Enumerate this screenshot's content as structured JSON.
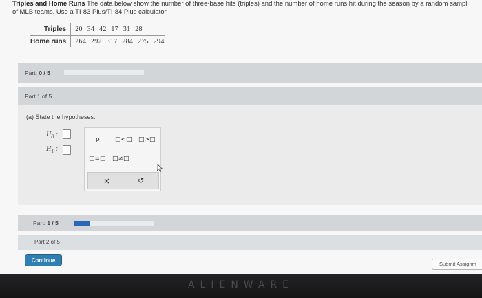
{
  "question": {
    "title": "Triples and Home Runs",
    "text_line1": "The data below show the number of three-base hits (triples) and the number of home runs hit during the season by a random sampl",
    "text_line2": "of MLB teams. Use a TI-83 Plus/TI-84 Plus calculator."
  },
  "table": {
    "row1_label": "Triples",
    "row1_values": "20 34 42 17 31 28",
    "row2_label": "Home runs",
    "row2_values": "264 292 317 284 275 294"
  },
  "part_header": {
    "label": "Part:",
    "value": "0 / 5",
    "progress": 0
  },
  "part1": {
    "title": "Part 1 of 5",
    "prompt": "(a) State the hypotheses.",
    "h0_label": "H",
    "h0_sub": "0",
    "h1_label": "H",
    "h1_sub": "1",
    "colon": ":"
  },
  "palette": {
    "rho": "ρ",
    "less_than": "□<□",
    "greater_than": "□>□",
    "equals": "□=□",
    "not_equals": "□≠□",
    "clear": "×",
    "undo": "↺"
  },
  "part_footer": {
    "label": "Part:",
    "value": "1 / 5",
    "progress": 0.2
  },
  "part2": {
    "title": "Part 2 of 5"
  },
  "buttons": {
    "continue": "Continue",
    "submit": "Submit Assignm"
  },
  "bezel": {
    "brand": "ALIENWARE"
  },
  "colors": {
    "accent": "#2a67b8",
    "button": "#2f7fb3",
    "bar": "#d3d6d8"
  }
}
